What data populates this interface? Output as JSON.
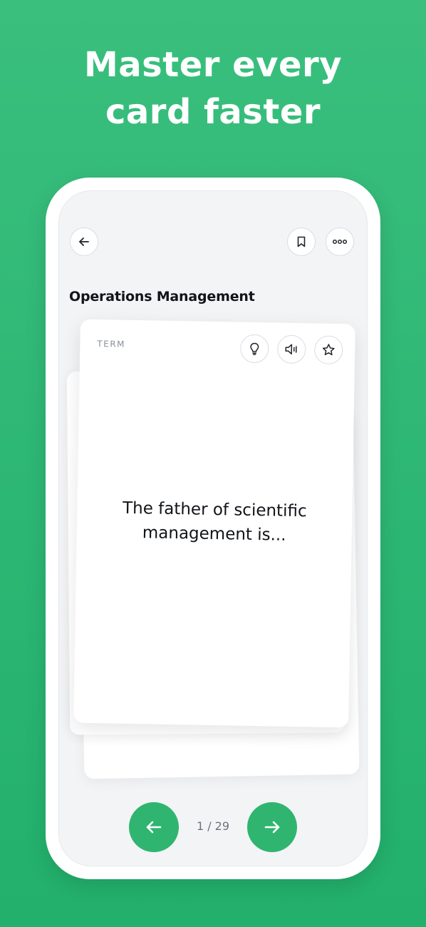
{
  "headline": {
    "line1": "Master every",
    "line2": "card faster"
  },
  "header": {
    "back_icon": "arrow-left-icon",
    "bookmark_icon": "bookmark-icon",
    "more_icon": "more-horizontal-icon"
  },
  "deck": {
    "title": "Operations Management"
  },
  "card": {
    "side_label": "TERM",
    "text_line1": "The father of scientific",
    "text_line2": "management is...",
    "icons": [
      "lightbulb-icon",
      "speaker-icon",
      "star-icon"
    ]
  },
  "navigation": {
    "prev_icon": "arrow-left-icon",
    "next_icon": "arrow-right-icon",
    "counter": "1 / 29"
  },
  "colors": {
    "background": "#2fb56f",
    "accent": "#2fb56f",
    "text": "#111418",
    "muted": "#8a9099"
  }
}
